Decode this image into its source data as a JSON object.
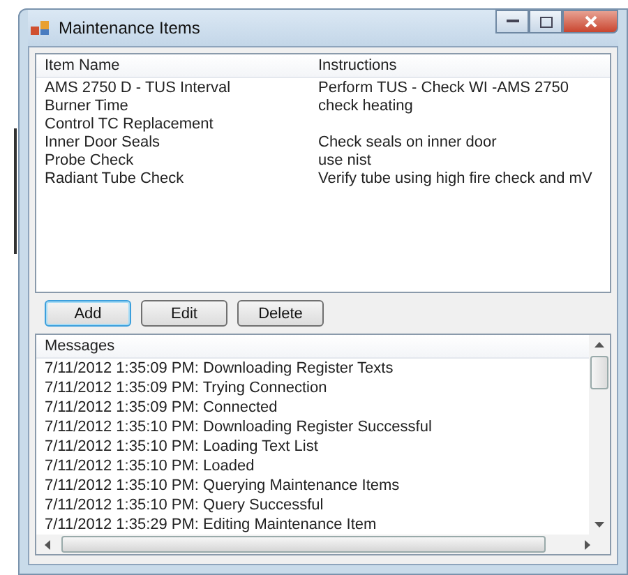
{
  "window": {
    "title": "Maintenance Items"
  },
  "items_table": {
    "columns": [
      "Item Name",
      "Instructions"
    ],
    "rows": [
      [
        "AMS 2750 D - TUS Interval",
        "Perform TUS - Check WI -AMS 2750"
      ],
      [
        "Burner Time",
        "check heating"
      ],
      [
        "Control TC Replacement",
        ""
      ],
      [
        "Inner Door Seals",
        "Check seals on inner door"
      ],
      [
        "Probe Check",
        "use nist"
      ],
      [
        "Radiant Tube Check",
        "Verify tube using high fire check and mV"
      ]
    ]
  },
  "buttons": [
    {
      "label": "Add",
      "focused": true
    },
    {
      "label": "Edit",
      "focused": false
    },
    {
      "label": "Delete",
      "focused": false
    }
  ],
  "messages": {
    "heading": "Messages",
    "lines": [
      "7/11/2012 1:35:09 PM: Downloading Register Texts",
      "7/11/2012 1:35:09 PM: Trying Connection",
      "7/11/2012 1:35:09 PM: Connected",
      "7/11/2012 1:35:10 PM: Downloading Register Successful",
      "7/11/2012 1:35:10 PM: Loading Text List",
      "7/11/2012 1:35:10 PM: Loaded",
      "7/11/2012 1:35:10 PM: Querying Maintenance Items",
      "7/11/2012 1:35:10 PM: Query Successful",
      "7/11/2012 1:35:29 PM: Editing Maintenance Item"
    ]
  }
}
